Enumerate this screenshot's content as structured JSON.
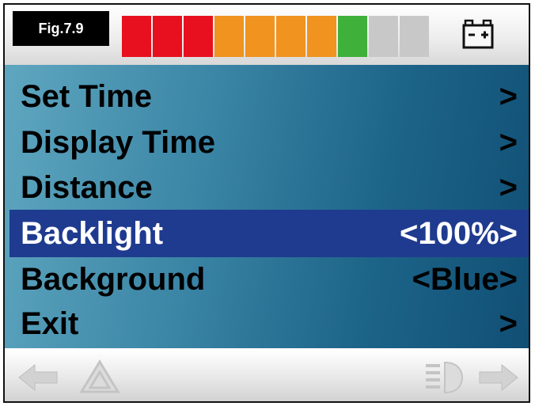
{
  "figure_label": "Fig.7.9",
  "battery": {
    "level": 0.8,
    "segments": [
      "#e8101e",
      "#e8101e",
      "#e8101e",
      "#f0931f",
      "#f0931f",
      "#f0931f",
      "#f0931f",
      "#3fb03a",
      "#c8c8c8",
      "#c8c8c8"
    ]
  },
  "menu": {
    "items": [
      {
        "label": "Set Time",
        "value": ">"
      },
      {
        "label": "Display Time",
        "value": ">"
      },
      {
        "label": "Distance",
        "value": ">"
      },
      {
        "label": "Backlight",
        "value": "<100%>"
      },
      {
        "label": "Background",
        "value": "<Blue>"
      },
      {
        "label": "Exit",
        "value": ">"
      }
    ],
    "selected_index": 3
  },
  "bottom_icons": [
    "arrow-left-icon",
    "warning-triangle-icon",
    "headlight-icon",
    "arrow-right-icon"
  ],
  "colors": {
    "selected_row": "#1f3b8f"
  }
}
